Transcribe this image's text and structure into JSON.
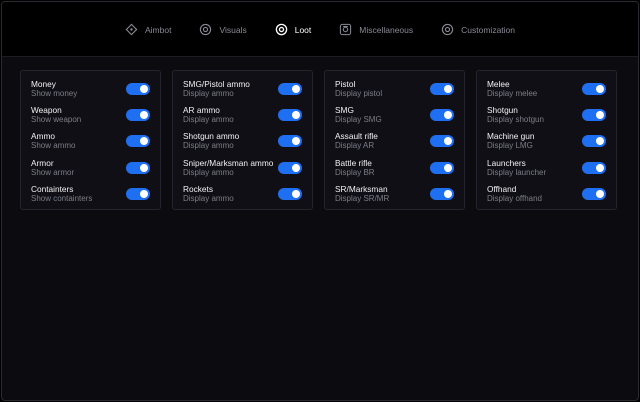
{
  "tabs": [
    {
      "label": "Aimbot",
      "icon": "crosshair-icon",
      "active": false
    },
    {
      "label": "Visuals",
      "icon": "eye-icon",
      "active": false
    },
    {
      "label": "Loot",
      "icon": "eye-icon",
      "active": true
    },
    {
      "label": "Miscellaneous",
      "icon": "misc-icon",
      "active": false
    },
    {
      "label": "Customization",
      "icon": "eye-icon",
      "active": false
    }
  ],
  "panels": [
    {
      "items": [
        {
          "title": "Money",
          "sub": "Show money",
          "on": true
        },
        {
          "title": "Weapon",
          "sub": "Show weapon",
          "on": true
        },
        {
          "title": "Ammo",
          "sub": "Show ammo",
          "on": true
        },
        {
          "title": "Armor",
          "sub": "Show armor",
          "on": true
        },
        {
          "title": "Containters",
          "sub": "Show containters",
          "on": true
        }
      ]
    },
    {
      "items": [
        {
          "title": "SMG/Pistol ammo",
          "sub": "Display ammo",
          "on": true
        },
        {
          "title": "AR ammo",
          "sub": "Display ammo",
          "on": true
        },
        {
          "title": "Shotgun ammo",
          "sub": "Display ammo",
          "on": true
        },
        {
          "title": "Sniper/Marksman ammo",
          "sub": "Display ammo",
          "on": true
        },
        {
          "title": "Rockets",
          "sub": "Display ammo",
          "on": true
        }
      ]
    },
    {
      "items": [
        {
          "title": "Pistol",
          "sub": "Display pistol",
          "on": true
        },
        {
          "title": "SMG",
          "sub": "Display SMG",
          "on": true
        },
        {
          "title": "Assault rifle",
          "sub": "Display AR",
          "on": true
        },
        {
          "title": "Battle rifle",
          "sub": "Display BR",
          "on": true
        },
        {
          "title": "SR/Marksman",
          "sub": "Display SR/MR",
          "on": true
        }
      ]
    },
    {
      "items": [
        {
          "title": "Melee",
          "sub": "Display melee",
          "on": true
        },
        {
          "title": "Shotgun",
          "sub": "Display shotgun",
          "on": true
        },
        {
          "title": "Machine gun",
          "sub": "Display LMG",
          "on": true
        },
        {
          "title": "Launchers",
          "sub": "Display launcher",
          "on": true
        },
        {
          "title": "Offhand",
          "sub": "Display offhand",
          "on": true
        }
      ]
    }
  ],
  "colors": {
    "accent": "#1f6ff2",
    "active_tab": "#ffffff",
    "inactive_tab": "#8a8a96"
  }
}
